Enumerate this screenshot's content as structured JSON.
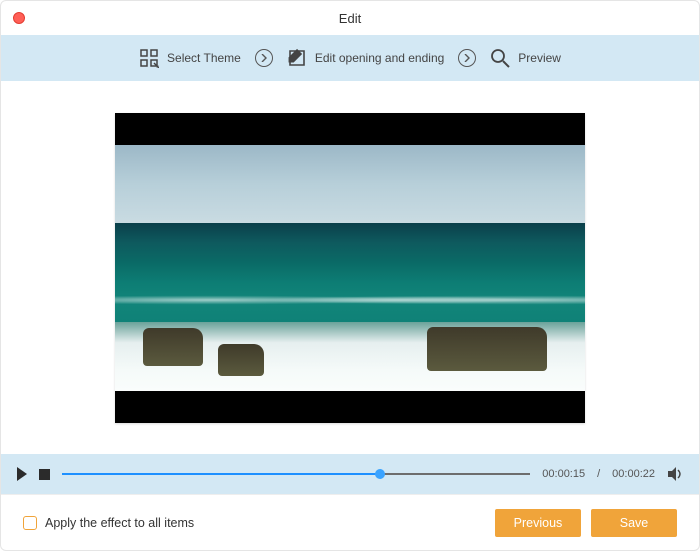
{
  "window": {
    "title": "Edit"
  },
  "toolbar": {
    "select_theme": "Select Theme",
    "edit_opening_ending": "Edit opening and ending",
    "preview": "Preview"
  },
  "transport": {
    "current_time": "00:00:15",
    "duration": "00:00:22",
    "separator": "/",
    "progress_percent": 68
  },
  "footer": {
    "apply_all_label": "Apply the effect to all items",
    "apply_all_checked": false,
    "previous_label": "Previous",
    "save_label": "Save"
  },
  "colors": {
    "toolbar_bg": "#d3e8f4",
    "accent": "#1e90ff",
    "button": "#f0a43a"
  }
}
